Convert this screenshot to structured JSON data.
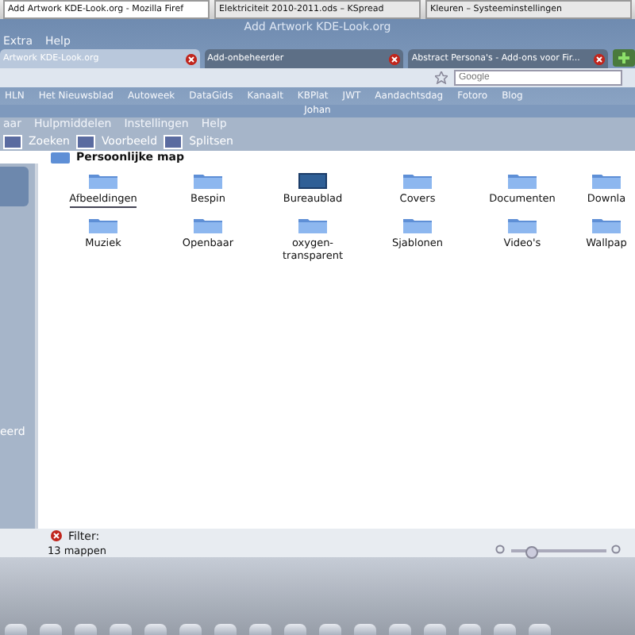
{
  "taskbar": {
    "tasks": [
      {
        "label": "Add Artwork KDE-Look.org - Mozilla Firef",
        "selected": true
      },
      {
        "label": "Elektriciteit 2010-2011.ods – KSpread",
        "selected": false
      },
      {
        "label": "Kleuren – Systeeminstellingen",
        "selected": false
      }
    ]
  },
  "browser": {
    "title": "Add Artwork KDE-Look.org",
    "menu": [
      "Extra",
      "Help"
    ],
    "tabs": [
      {
        "label": "Artwork KDE-Look.org",
        "selected": true
      },
      {
        "label": "Add-onbeheerder",
        "selected": false
      },
      {
        "label": "Abstract Persona's - Add-ons voor Fir...",
        "selected": false
      }
    ],
    "search": {
      "placeholder": "Google"
    },
    "bookmarks": [
      "HLN",
      "Het Nieuwsblad",
      "Autoweek",
      "DataGids",
      "Kanaalt",
      "KBPlat",
      "JWT",
      "Aandachtsdag",
      "Fotoro",
      "Blog"
    ]
  },
  "file_manager": {
    "title": "Johan",
    "menu": [
      "aar",
      "Hulpmiddelen",
      "Instellingen",
      "Help"
    ],
    "toolbar": [
      "Zoeken",
      "Voorbeeld",
      "Splitsen"
    ],
    "breadcrumb": "Persoonlijke map",
    "sidebar": {
      "items": [
        "eerd"
      ]
    },
    "folders": [
      {
        "name": "Afbeeldingen",
        "kind": "folder",
        "selected": true
      },
      {
        "name": "Bespin",
        "kind": "folder",
        "selected": false
      },
      {
        "name": "Bureaublad",
        "kind": "desktop",
        "selected": false
      },
      {
        "name": "Covers",
        "kind": "folder",
        "selected": false
      },
      {
        "name": "Documenten",
        "kind": "folder",
        "selected": false
      },
      {
        "name": "Downla",
        "kind": "folder",
        "selected": false
      },
      {
        "name": "Muziek",
        "kind": "folder",
        "selected": false
      },
      {
        "name": "Openbaar",
        "kind": "folder",
        "selected": false
      },
      {
        "name": "oxygen-transparent",
        "kind": "folder",
        "selected": false
      },
      {
        "name": "Sjablonen",
        "kind": "folder",
        "selected": false
      },
      {
        "name": "Video's",
        "kind": "folder",
        "selected": false
      },
      {
        "name": "Wallpap",
        "kind": "folder",
        "selected": false
      }
    ],
    "filter": {
      "label": "Filter:"
    },
    "status": "13 mappen",
    "zoom": {
      "level": 0.2
    }
  }
}
